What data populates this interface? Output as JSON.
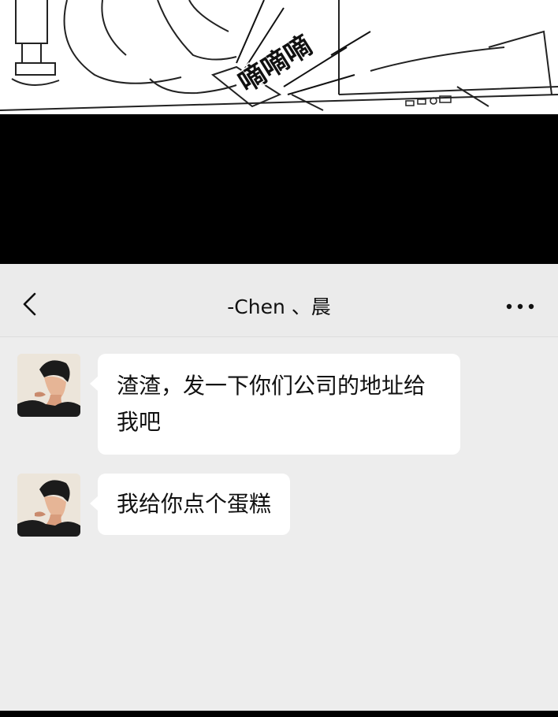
{
  "comic": {
    "sound_effect": "嘀嘀嘀"
  },
  "chat": {
    "back_icon": "chevron-left-icon",
    "title": "-Chen 、晨",
    "more_icon": "more-dots-icon",
    "messages": [
      {
        "text": "渣渣，发一下你们公司的地址给我吧"
      },
      {
        "text": "我给你点个蛋糕"
      }
    ]
  },
  "colors": {
    "chat_background": "#ededed",
    "bubble": "#ffffff",
    "header": "#ebebeb"
  }
}
